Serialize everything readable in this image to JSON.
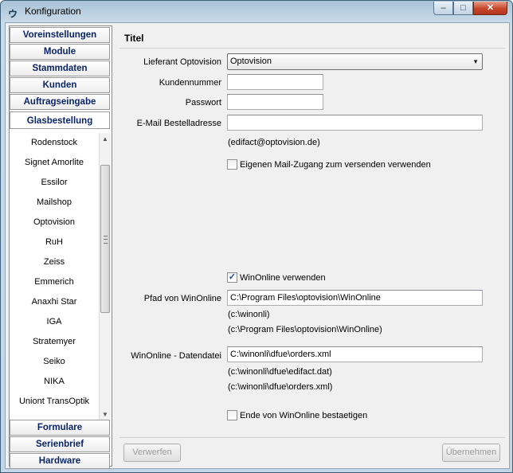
{
  "window": {
    "title": "Konfiguration"
  },
  "nav": {
    "top": [
      "Voreinstellungen",
      "Module",
      "Stammdaten",
      "Kunden",
      "Auftragseingabe"
    ],
    "active": "Glasbestellung",
    "bottom": [
      "Formulare",
      "Serienbrief",
      "Hardware"
    ],
    "items": [
      "Rodenstock",
      "Signet Amorlite",
      "Essilor",
      "Mailshop",
      "Optovision",
      "RuH",
      "Zeiss",
      "Emmerich",
      "Anaxhi Star",
      "IGA",
      "Stratemyer",
      "Seiko",
      "NIKA",
      "Uniont TransOptik"
    ]
  },
  "panel": {
    "title": "Titel",
    "supplier_label": "Lieferant Optovision",
    "supplier_value": "Optovision",
    "customer_label": "Kundennummer",
    "customer_value": "",
    "password_label": "Passwort",
    "password_value": "",
    "email_label": "E-Mail Bestelladresse",
    "email_value": "",
    "email_hint": "(edifact@optovision.de)",
    "own_mail_label": "Eigenen Mail-Zugang zum versenden verwenden",
    "own_mail_checked": false,
    "winonline_label": "WinOnline verwenden",
    "winonline_checked": true,
    "path_label": "Pfad von WinOnline",
    "path_value": "C:\\Program Files\\optovision\\WinOnline",
    "path_hint1": "(c:\\winonli)",
    "path_hint2": "(c:\\Program Files\\optovision\\WinOnline)",
    "datafile_label": "WinOnline - Datendatei",
    "datafile_value": "C:\\winonli\\dfue\\orders.xml",
    "datafile_hint1": "(c:\\winonli\\dfue\\edifact.dat)",
    "datafile_hint2": "(c:\\winonli\\dfue\\orders.xml)",
    "confirm_end_label": "Ende von WinOnline bestaetigen",
    "confirm_end_checked": false
  },
  "buttons": {
    "discard": "Verwerfen",
    "apply": "Übernehmen"
  }
}
